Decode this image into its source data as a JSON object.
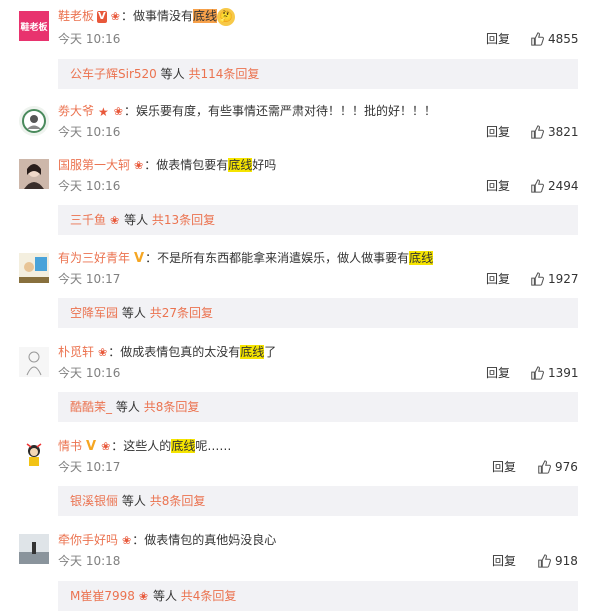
{
  "comments": [
    {
      "user": "鞋老板",
      "avatar_text": "鞋老板",
      "text_before": "：做事情没有",
      "highlight": "底线",
      "text_after": "",
      "time": "今天 10:16",
      "reply": "回复",
      "likes": "4855",
      "sub_user": "公车子辉Sir520",
      "sub_middle": "等人",
      "sub_count": "共114条回复"
    },
    {
      "user": "劵大爷",
      "text_before": "：娱乐要有度，有些事情还需严肃对待！！！批的好！！！",
      "highlight": "",
      "text_after": "",
      "time": "今天 10:16",
      "reply": "回复",
      "likes": "3821"
    },
    {
      "user": "国服第一大轲",
      "text_before": "：做表情包要有",
      "highlight": "底线",
      "text_after": "好吗",
      "time": "今天 10:16",
      "reply": "回复",
      "likes": "2494",
      "sub_user": "三千鱼",
      "sub_middle": "等人",
      "sub_count": "共13条回复"
    },
    {
      "user": "有为三好青年",
      "text_before": "：不是所有东西都能拿来消遣娱乐，做人做事要有",
      "highlight": "底线",
      "text_after": "",
      "time": "今天 10:17",
      "reply": "回复",
      "likes": "1927",
      "sub_user": "空降军园",
      "sub_middle": "等人",
      "sub_count": "共27条回复"
    },
    {
      "user": "朴觅轩",
      "text_before": "：做成表情包真的太没有",
      "highlight": "底线",
      "text_after": "了",
      "time": "今天 10:16",
      "reply": "回复",
      "likes": "1391",
      "sub_user": "酷酷茉_",
      "sub_middle": "等人",
      "sub_count": "共8条回复"
    },
    {
      "user": "情书",
      "text_before": "：这些人的",
      "highlight": "底线",
      "text_after": "呢……",
      "time": "今天 10:17",
      "reply": "回复",
      "likes": "976",
      "sub_user": "银溪银俪",
      "sub_middle": "等人",
      "sub_count": "共8条回复"
    },
    {
      "user": "牵你手好吗",
      "text_before": "：做表情包的真他妈没良心",
      "highlight": "",
      "text_after": "",
      "time": "今天 10:18",
      "reply": "回复",
      "likes": "918",
      "sub_user": "M崔崔7998",
      "sub_middle": "等人",
      "sub_count": "共4条回复"
    }
  ],
  "icons": {
    "verified": "verified-badge-icon",
    "fan": "fan-badge-icon",
    "like": "thumbs-up-icon"
  },
  "colors": {
    "username": "#eb7350",
    "highlight": "#f5e400",
    "sub_bg": "#f2f2f5"
  }
}
